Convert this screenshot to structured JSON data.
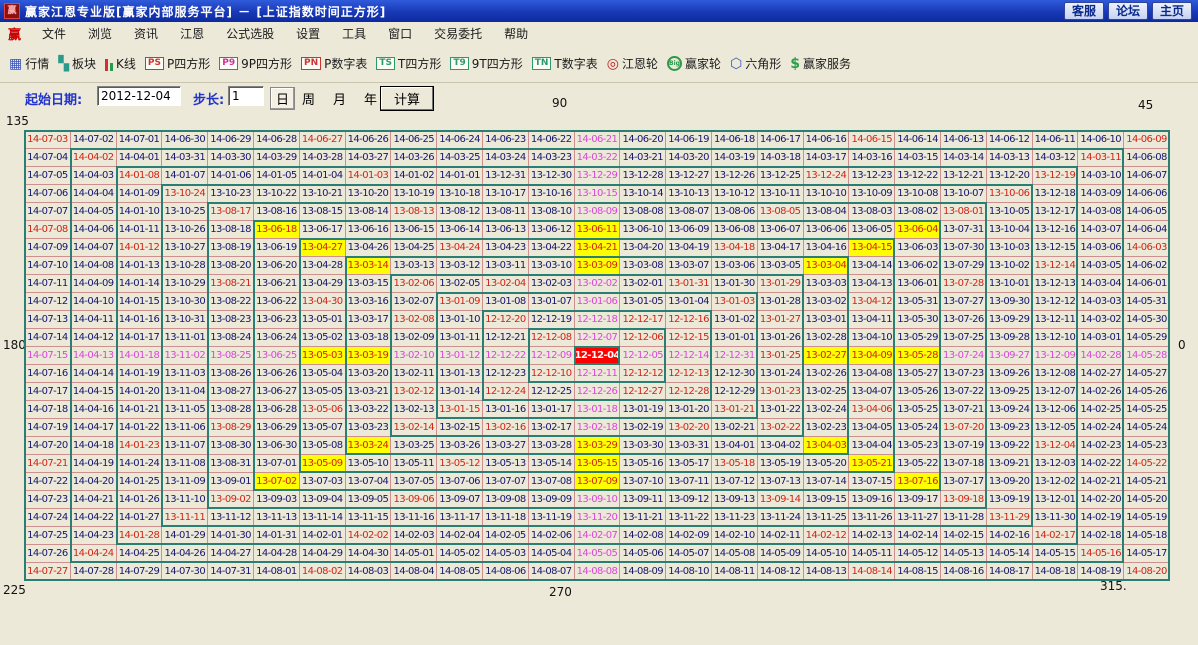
{
  "window": {
    "title": "赢家江恩专业版[赢家内部服务平台] － [上证指数时间正方形]",
    "logo": "赢",
    "buttons": [
      {
        "label": "客服"
      },
      {
        "label": "论坛"
      },
      {
        "label": "主页"
      }
    ]
  },
  "menu": {
    "logo": "赢",
    "items": [
      "文件",
      "浏览",
      "资讯",
      "江恩",
      "公式选股",
      "设置",
      "工具",
      "窗口",
      "交易委托",
      "帮助"
    ]
  },
  "toolbar": {
    "items": [
      {
        "name": "quotes",
        "label": "行情",
        "icon": "table",
        "color": "#3a55c0"
      },
      {
        "name": "sectors",
        "label": "板块",
        "icon": "blocks",
        "color": "#2a9a8a"
      },
      {
        "name": "kline",
        "label": "K线",
        "icon": "candles",
        "color": "#d03030"
      },
      {
        "name": "p-square",
        "label": "P四方形",
        "icon": "badge",
        "badge": "PS",
        "color": "#cc3333"
      },
      {
        "name": "9p-square",
        "label": "9P四方形",
        "icon": "badge",
        "badge": "P9",
        "color": "#cc3399"
      },
      {
        "name": "p-number-table",
        "label": "P数字表",
        "icon": "badge",
        "badge": "PN",
        "color": "#cc3333"
      },
      {
        "name": "t-square",
        "label": "T四方形",
        "icon": "badge",
        "badge": "TS",
        "color": "#2a9a6a"
      },
      {
        "name": "9t-square",
        "label": "9T四方形",
        "icon": "badge",
        "badge": "T9",
        "color": "#2a9a6a"
      },
      {
        "name": "t-number-table",
        "label": "T数字表",
        "icon": "badge",
        "badge": "TN",
        "color": "#2a9a6a"
      },
      {
        "name": "gann-wheel",
        "label": "江恩轮",
        "icon": "wheel",
        "color": "#bb2222"
      },
      {
        "name": "winner-wheel",
        "label": "赢家轮",
        "icon": "bigwheel",
        "color": "#2a9a4a"
      },
      {
        "name": "hexagon",
        "label": "六角形",
        "icon": "hexagon",
        "color": "#3a55c0"
      },
      {
        "name": "winner-service",
        "label": "赢家服务",
        "icon": "dollar",
        "color": "#2aa04a"
      }
    ]
  },
  "controls": {
    "start_label": "起始日期:",
    "start_value": "2012-12-04",
    "step_label": "步长:",
    "step_value": "1",
    "periods": [
      "日",
      "周",
      "月",
      "年"
    ],
    "period_selected": "日",
    "calc_label": "计算"
  },
  "angle_labels": {
    "top_left": "135",
    "top": "90",
    "top_right": "45",
    "left": "180",
    "right": "0",
    "bottom_left": "225",
    "bottom": "270",
    "bottom_right": "315."
  },
  "grid": {
    "rows": 25,
    "cols": 25,
    "center_date": "2012-12-04",
    "center_display": "12-12-04",
    "step_days": 1,
    "date_format": "YY-MM-DD",
    "spiral": "counterclockwise, day 2 to the right of center, each ring ends at its bottom-right corner",
    "corner_dates": {
      "top_left": "14-07-03",
      "top_right": "14-06-09",
      "bottom_left": "14-07-27",
      "bottom_right": "14-08-20"
    },
    "rules": {
      "diagonal_cells": "red text",
      "center_row_and_column": "magenta text"
    },
    "colors": {
      "default_text": "#151570",
      "red_text": "#d42316",
      "magenta_text": "#dd44dd",
      "yellow_bg": "#ffff00",
      "center_bg": "#ff0000",
      "center_text": "#ffffff",
      "grid_line": "#cf8f8f",
      "ring_border": "#2b7e74",
      "cell_bg": "#ece9d8"
    },
    "yellow_cells": [
      [
        6,
        6,
        "13-06-18"
      ],
      [
        6,
        13,
        "13-06-11"
      ],
      [
        6,
        20,
        "13-06-04"
      ],
      [
        7,
        7,
        "13-04-27"
      ],
      [
        7,
        13,
        "13-04-21"
      ],
      [
        7,
        19,
        "13-04-15"
      ],
      [
        8,
        8,
        "13-03-14"
      ],
      [
        8,
        13,
        "13-03-09"
      ],
      [
        8,
        18,
        "13-03-04"
      ],
      [
        13,
        7,
        "13-05-03"
      ],
      [
        13,
        8,
        "13-03-19"
      ],
      [
        13,
        18,
        "13-02-27"
      ],
      [
        13,
        19,
        "13-04-09"
      ],
      [
        13,
        20,
        "13-05-28"
      ],
      [
        18,
        8,
        "13-03-24"
      ],
      [
        18,
        13,
        "13-03-29"
      ],
      [
        18,
        18,
        "13-04-03"
      ],
      [
        19,
        7,
        "13-05-09"
      ],
      [
        19,
        13,
        "13-05-15"
      ],
      [
        19,
        19,
        "13-05-21"
      ],
      [
        20,
        6,
        "13-07-02"
      ],
      [
        20,
        13,
        "13-07-09"
      ],
      [
        20,
        20,
        "13-07-16"
      ]
    ],
    "red_cells_extra": [
      [
        1,
        7,
        "14-06-27"
      ],
      [
        1,
        19,
        "14-06-15"
      ],
      [
        3,
        8,
        "14-01-03"
      ],
      [
        3,
        18,
        "13-12-24"
      ],
      [
        5,
        9,
        "13-08-13"
      ],
      [
        5,
        17,
        "13-08-05"
      ],
      [
        6,
        1,
        "14-07-08"
      ],
      [
        7,
        3,
        "14-01-12"
      ],
      [
        7,
        10,
        "13-04-24"
      ],
      [
        7,
        16,
        "13-04-18"
      ],
      [
        7,
        25,
        "14-06-03"
      ],
      [
        8,
        23,
        "13-12-14"
      ],
      [
        9,
        5,
        "13-08-21"
      ],
      [
        9,
        11,
        "13-02-04"
      ],
      [
        9,
        15,
        "13-01-31"
      ],
      [
        9,
        21,
        "13-07-28"
      ],
      [
        10,
        7,
        "13-04-30"
      ],
      [
        10,
        19,
        "13-04-12"
      ],
      [
        11,
        9,
        "13-02-08"
      ],
      [
        11,
        14,
        "12-12-17"
      ],
      [
        11,
        17,
        "13-01-27"
      ],
      [
        12,
        15,
        "12-12-15"
      ],
      [
        13,
        17,
        "13-01-25"
      ],
      [
        14,
        15,
        "12-12-13"
      ],
      [
        15,
        9,
        "13-02-12"
      ],
      [
        15,
        14,
        "12-12-27"
      ],
      [
        15,
        17,
        "13-01-23"
      ],
      [
        16,
        7,
        "13-05-06"
      ],
      [
        16,
        19,
        "13-04-06"
      ],
      [
        17,
        5,
        "13-08-29"
      ],
      [
        17,
        11,
        "13-02-16"
      ],
      [
        17,
        15,
        "13-02-20"
      ],
      [
        17,
        21,
        "13-07-20"
      ],
      [
        18,
        3,
        "14-01-23"
      ],
      [
        18,
        23,
        "13-12-04"
      ],
      [
        19,
        1,
        "14-07-21"
      ],
      [
        19,
        10,
        "13-05-12"
      ],
      [
        19,
        16,
        "13-05-18"
      ],
      [
        19,
        25,
        "14-05-22"
      ],
      [
        21,
        9,
        "13-09-06"
      ],
      [
        21,
        17,
        "13-09-14"
      ],
      [
        23,
        8,
        "14-02-02"
      ],
      [
        23,
        18,
        "14-02-12"
      ],
      [
        25,
        7,
        "14-08-02"
      ],
      [
        25,
        19,
        "14-08-14"
      ]
    ]
  }
}
